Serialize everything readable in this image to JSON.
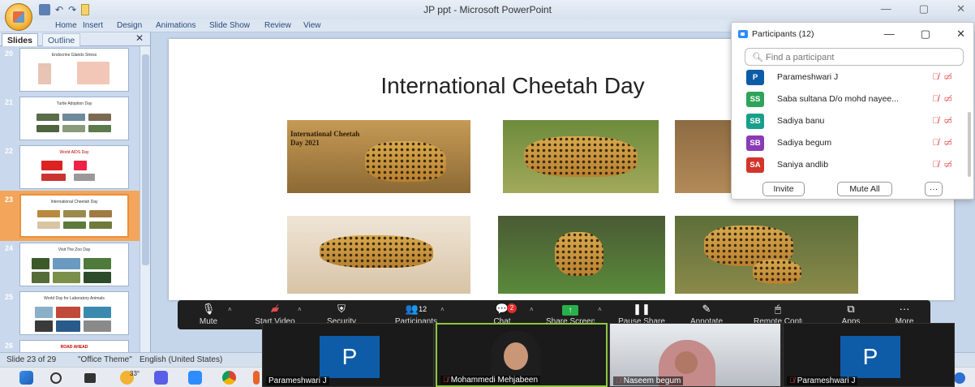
{
  "window": {
    "title": "JP ppt - Microsoft PowerPoint",
    "controls": {
      "minimize": "—",
      "maximize": "▢",
      "close": "✕"
    }
  },
  "ribbon": {
    "tabs": [
      "Home",
      "Insert",
      "Design",
      "Animations",
      "Slide Show",
      "Review",
      "View"
    ]
  },
  "slides_pane": {
    "tabs": {
      "slides": "Slides",
      "outline": "Outline"
    },
    "close": "✕",
    "thumbnails": [
      {
        "number": "20",
        "title": "Endocrine Glands Stress"
      },
      {
        "number": "21",
        "title": "Turtle Adoption Day"
      },
      {
        "number": "22",
        "title": "World AIDS Day"
      },
      {
        "number": "23",
        "title": "International Cheetah Day",
        "selected": true
      },
      {
        "number": "24",
        "title": "Visit The Zoo Day"
      },
      {
        "number": "25",
        "title": "World Day for Laboratory Animals"
      },
      {
        "number": "26",
        "title": "ROAD AHEAD"
      }
    ]
  },
  "slide": {
    "title": "International Cheetah Day",
    "photo_caption": "International Cheetah Day 2021"
  },
  "statusbar": {
    "slide_info": "Slide 23 of 29",
    "theme": "\"Office Theme\"",
    "language": "English (United States)"
  },
  "zoom_toolbar": {
    "items": [
      {
        "label": "Mute",
        "icon": "microphone-icon"
      },
      {
        "label": "Start Video",
        "icon": "video-off-icon"
      },
      {
        "label": "Security",
        "icon": "shield-icon"
      },
      {
        "label": "Participants",
        "icon": "participants-icon",
        "count": "12"
      },
      {
        "label": "Chat",
        "icon": "chat-icon",
        "badge": "2"
      },
      {
        "label": "Share Screen",
        "icon": "share-screen-icon"
      },
      {
        "label": "Pause Share",
        "icon": "pause-icon"
      },
      {
        "label": "Annotate",
        "icon": "pencil-icon"
      },
      {
        "label": "Remote Control",
        "icon": "remote-control-icon"
      },
      {
        "label": "Apps",
        "icon": "apps-icon"
      },
      {
        "label": "More",
        "icon": "more-icon"
      }
    ]
  },
  "video_tiles": [
    {
      "name": "Parameshwari J",
      "initial": "P",
      "muted": false
    },
    {
      "name": "Mohammedi Mehjabeen",
      "muted": true,
      "active": true
    },
    {
      "name": "Naseem begum",
      "muted": true
    },
    {
      "name": "Parameshwari J",
      "initial": "P",
      "muted": true
    }
  ],
  "participants_panel": {
    "title": "Participants (12)",
    "search_placeholder": "Find a participant",
    "participants": [
      {
        "initials": "P",
        "name": "Parameshwari J",
        "color": "#0e5ca8"
      },
      {
        "initials": "SS",
        "name": "Saba sultana D/o mohd nayee...",
        "color": "#2ea45a"
      },
      {
        "initials": "SB",
        "name": "Sadiya banu",
        "color": "#1a9e8c"
      },
      {
        "initials": "SB",
        "name": "Sadiya begum",
        "color": "#8b3bb5"
      },
      {
        "initials": "SA",
        "name": "Saniya andlib",
        "color": "#d2352b"
      }
    ],
    "buttons": {
      "invite": "Invite",
      "mute_all": "Mute All",
      "more": "···"
    }
  },
  "taskbar": {
    "weather": "33°"
  },
  "colors": {
    "zoom_toolbar_bg": "#1f1f1f",
    "active_speaker_border": "#8dc63f",
    "muted_red": "#e34c4c",
    "zoom_blue": "#2d8cff"
  }
}
